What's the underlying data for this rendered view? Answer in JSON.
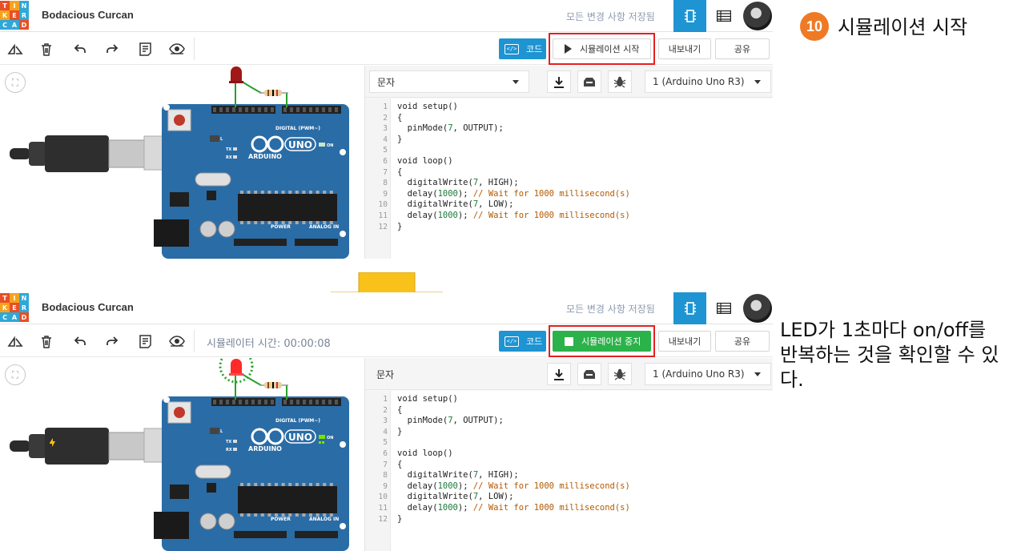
{
  "app": {
    "logo_letters": [
      "T",
      "I",
      "N",
      "K",
      "E",
      "R",
      "C",
      "A",
      "D"
    ],
    "logo_colors": [
      "#e84f26",
      "#f6a21d",
      "#2ea8d8",
      "#f6a21d",
      "#e84f26",
      "#2ea8d8",
      "#2ea8d8",
      "#2ea8d8",
      "#e84f26"
    ],
    "project_title": "Bodacious Curcan",
    "saved_status": "모든 변경 사항 저장됨"
  },
  "colors": {
    "accent": "#1e94d2",
    "sim_stop": "#2cb24a",
    "highlight": "#e51f1f",
    "step_badge": "#ef7a25",
    "arrow": "#f9c21b"
  },
  "icons": {
    "toolbar": [
      "rotate-icon",
      "trash-icon",
      "undo-icon",
      "redo-icon",
      "notes-icon",
      "eye-icon"
    ]
  },
  "top": {
    "code_button": "코드",
    "sim_button": "시뮬레이션 시작",
    "export_button": "내보내기",
    "share_button": "공유",
    "mode_select": "문자",
    "board_select": "1 (Arduino Uno R3)"
  },
  "bottom": {
    "sim_time": "시뮬레이터 시간: 00:00:08",
    "code_button": "코드",
    "sim_button": "시뮬레이션 중지",
    "export_button": "내보내기",
    "share_button": "공유",
    "mode_select": "문자",
    "board_select": "1 (Arduino Uno R3)"
  },
  "board_labels": {
    "uno": "UNO",
    "arduino": "ARDUINO",
    "digital": "DIGITAL (PWM~)",
    "power": "POWER",
    "analog": "ANALOG IN",
    "on": "ON",
    "tx": "TX",
    "rx": "RX",
    "l": "L"
  },
  "code": [
    {
      "n": "1",
      "text": "void setup()"
    },
    {
      "n": "2",
      "text": "{"
    },
    {
      "n": "3",
      "text": "  pinMode(7, OUTPUT);"
    },
    {
      "n": "4",
      "text": "}"
    },
    {
      "n": "5",
      "text": ""
    },
    {
      "n": "6",
      "text": "void loop()"
    },
    {
      "n": "7",
      "text": "{"
    },
    {
      "n": "8",
      "text": "  digitalWrite(7, HIGH);"
    },
    {
      "n": "9",
      "text": "  delay(1000);",
      "comment": " // Wait for 1000 millisecond(s)"
    },
    {
      "n": "10",
      "text": "  digitalWrite(7, LOW);"
    },
    {
      "n": "11",
      "text": "  delay(1000);",
      "comment": " // Wait for 1000 millisecond(s)"
    },
    {
      "n": "12",
      "text": "}"
    }
  ],
  "annotation": {
    "step_number": "10",
    "step_label": "시뮬레이션 시작",
    "note": "LED가 1초마다 on/off를 반복하는 것을 확인할 수 있다."
  }
}
